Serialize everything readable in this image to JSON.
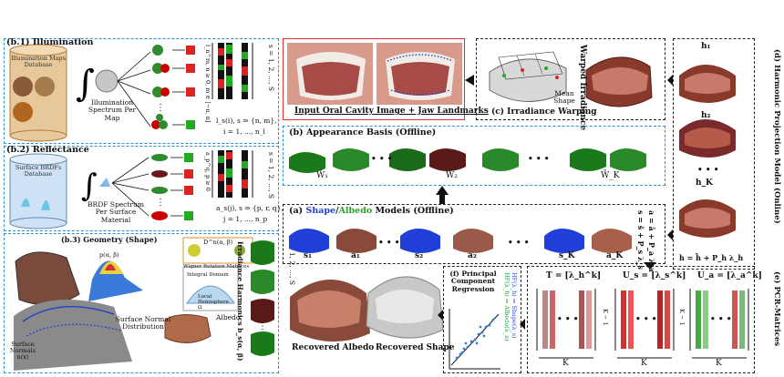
{
  "panels": {
    "b1": {
      "title": "(b.1) Illumination",
      "db_label": "Illumination Maps Database",
      "spectrum_label": "Illumination Spectrum Per Map",
      "index_vertical": "l_n^m, n ≥ 0, m ∈ [−n, n]",
      "s_range": "s = 1, 2, ..., S",
      "formula_l1": "l_s(i), s ⇒ {n, m},",
      "formula_l2": "i = 1, ..., n_l"
    },
    "b2": {
      "title": "(b.2) Reflectance",
      "db_label": "Surface BRDFs Database",
      "spectrum_label": "BRDF Spectrum Per Surface Material",
      "index_vertical": "a_p^q, p ≥ 0",
      "s_range": "s = 1, 2, ..., S",
      "formula_l1": "a_s(j), s ⇒ {p, r, q},",
      "formula_l2": "j = 1, ..., n_p"
    },
    "b3": {
      "title": "(b.3) Geometry (Shape)",
      "normal_dist": "Surface Normal Distribution",
      "normals_label": "Surface Normals n(x)",
      "pfunc": "p(α, β)",
      "wigner_formula": "D^n(α, β)",
      "wigner_label": "Wigner Rotation Matrices",
      "integral_domain": "Integral Domain",
      "local_hemisphere": "Local Hemisphere Ω",
      "albedo": "Albedo",
      "irr_label": "Irradiance Harmonics b_s(α, β)",
      "s_range": "s = 1, 2, ..., S"
    },
    "input": {
      "caption": "Input Oral Cavity Image + Jaw Landmarks"
    },
    "c": {
      "title": "(c) Irradiance Warping",
      "warped": "Warped Irradiance",
      "mean_shape": "Mean Shape"
    },
    "b": {
      "title": "(b) Appearance Basis (Offline)",
      "labels": [
        "W̄₁",
        "W̄₂",
        "W̄_K"
      ],
      "dots": "• • •"
    },
    "a": {
      "title_pre": "(a) ",
      "title_shape": "Shape",
      "title_sep": "/",
      "title_albedo": "Albedo",
      "title_post": " Models (Offline)",
      "labels": [
        "s₁",
        "a₁",
        "s₂",
        "a₂",
        "s_K",
        "a_K"
      ],
      "eq1": "a = ā + P_a λ_a",
      "eq2": "s = s̄ + P_s λ_s",
      "dots": "• • •"
    },
    "d": {
      "title": "(d) Harmonic Projection Model (Online)",
      "labels": [
        "h₁",
        "h₂",
        "h_K"
      ],
      "eq": "h = h̄ + P_h λ_h",
      "dots": "• • •"
    },
    "e": {
      "title": "(e) PCR-Matrices",
      "T": "T = [λ_h^k]",
      "Us": "U_s = [λ_s^k]",
      "Ua": "U_a = [λ_a^k]",
      "K": "K",
      "Km1": "K − 1",
      "dots": "• • •"
    },
    "f": {
      "title": "(f) Principal Component Regression",
      "v1": "HF(λ_h) ⇒ Shape(λ_s)",
      "v2": "HF(λ_h) ⇒ Albedo(λ_a)"
    },
    "recovered": {
      "albedo": "Recovered Albedo",
      "shape": "Recovered Shape"
    }
  },
  "colors": {
    "blue_dash": "#2a8fd8",
    "red": "#e03030",
    "green_matrix": "#1a9a2a",
    "shape_blue": "#1f3fd8",
    "albedo_green": "#2aa02a",
    "vertical_blue": "#3050e0",
    "vertical_green": "#20a040"
  }
}
